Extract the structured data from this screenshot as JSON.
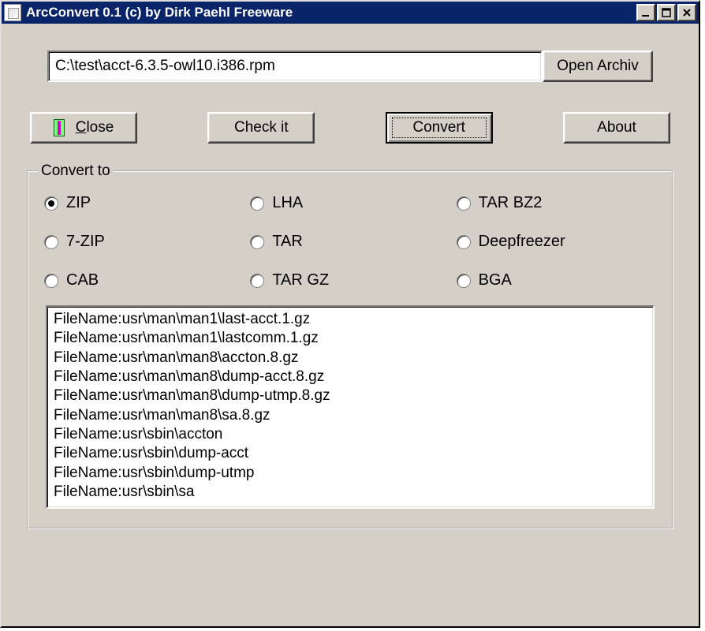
{
  "window": {
    "title": "ArcConvert 0.1 (c) by Dirk Paehl Freeware"
  },
  "file": {
    "path": "C:\\test\\acct-6.3.5-owl10.i386.rpm",
    "open_label": "Open Archiv"
  },
  "actions": {
    "close_label": "Close",
    "close_underline": "C",
    "check_label": "Check it",
    "convert_label": "Convert",
    "about_label": "About"
  },
  "group": {
    "legend": "Convert to",
    "options": [
      {
        "label": "ZIP",
        "selected": true
      },
      {
        "label": "LHA",
        "selected": false
      },
      {
        "label": "TAR BZ2",
        "selected": false
      },
      {
        "label": "7-ZIP",
        "selected": false
      },
      {
        "label": "TAR",
        "selected": false
      },
      {
        "label": "Deepfreezer",
        "selected": false
      },
      {
        "label": "CAB",
        "selected": false
      },
      {
        "label": "TAR GZ",
        "selected": false
      },
      {
        "label": "BGA",
        "selected": false
      }
    ]
  },
  "output_lines": [
    "FileName:usr\\man\\man1\\last-acct.1.gz",
    "FileName:usr\\man\\man1\\lastcomm.1.gz",
    "FileName:usr\\man\\man8\\accton.8.gz",
    "FileName:usr\\man\\man8\\dump-acct.8.gz",
    "FileName:usr\\man\\man8\\dump-utmp.8.gz",
    "FileName:usr\\man\\man8\\sa.8.gz",
    "FileName:usr\\sbin\\accton",
    "FileName:usr\\sbin\\dump-acct",
    "FileName:usr\\sbin\\dump-utmp",
    "FileName:usr\\sbin\\sa"
  ]
}
